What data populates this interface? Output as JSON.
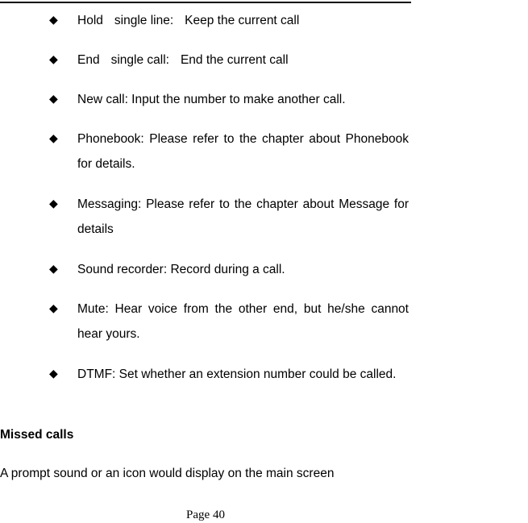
{
  "document": {
    "bullet_glyph": "◆",
    "list_items": [
      {
        "id": "hold-single-line",
        "segments": [
          "Hold",
          "single line:",
          "Keep the current call"
        ],
        "text": "Hold   single line:   Keep the current call",
        "justified": false,
        "tabbed": true
      },
      {
        "id": "end-single-call",
        "segments": [
          "End",
          "single call:",
          "End the current call"
        ],
        "text": "End   single call:   End the current call",
        "justified": false,
        "tabbed": true
      },
      {
        "id": "new-call",
        "text": "New call: Input the number to make another call.",
        "justified": false,
        "tabbed": false
      },
      {
        "id": "phonebook",
        "text": "Phonebook: Please refer to the chapter about Phonebook for details.",
        "justified": true,
        "tabbed": false
      },
      {
        "id": "messaging",
        "text": "Messaging: Please refer to the chapter about Message for details",
        "justified": true,
        "tabbed": false
      },
      {
        "id": "sound-recorder",
        "text": "Sound recorder: Record during a call.",
        "justified": false,
        "tabbed": false
      },
      {
        "id": "mute",
        "text": "Mute: Hear voice from the other end, but he/she cannot hear yours.",
        "justified": true,
        "tabbed": false
      },
      {
        "id": "dtmf",
        "text": "DTMF: Set whether an extension number could be called.",
        "justified": true,
        "tabbed": false
      }
    ],
    "heading": "Missed calls",
    "paragraph": "A prompt sound or an icon would display on the main screen",
    "footer": "Page 40"
  }
}
